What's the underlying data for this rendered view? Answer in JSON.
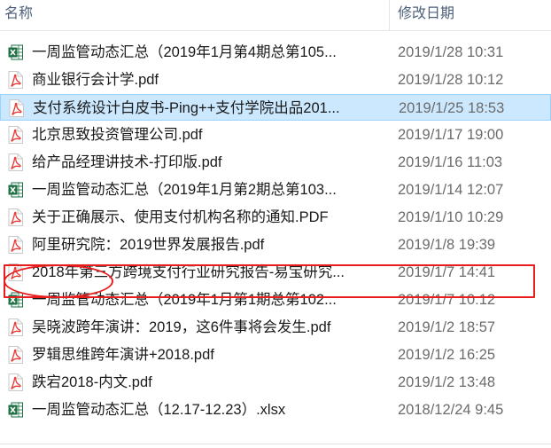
{
  "header": {
    "name_label": "名称",
    "date_label": "修改日期"
  },
  "colors": {
    "selection": "#cce8ff",
    "highlight": "#e81d1d",
    "pdf": "#e53935",
    "excel": "#1e7145"
  },
  "files": [
    {
      "name": "一周监管动态汇总（2019年1月第4期总第105...",
      "date": "2019/1/28 10:31",
      "icon": "excel-icon"
    },
    {
      "name": "商业银行会计学.pdf",
      "date": "2019/1/28 10:12",
      "icon": "pdf-icon"
    },
    {
      "name": "支付系统设计白皮书-Ping++支付学院出品201...",
      "date": "2019/1/25 18:53",
      "icon": "pdf-icon",
      "selected": true
    },
    {
      "name": "北京思致投资管理公司.pdf",
      "date": "2019/1/17 19:00",
      "icon": "pdf-icon"
    },
    {
      "name": "给产品经理讲技术-打印版.pdf",
      "date": "2019/1/16 11:03",
      "icon": "pdf-icon"
    },
    {
      "name": "一周监管动态汇总（2019年1月第2期总第103...",
      "date": "2019/1/14 12:07",
      "icon": "excel-icon"
    },
    {
      "name": "关于正确展示、使用支付机构名称的通知.PDF",
      "date": "2019/1/10 10:29",
      "icon": "pdf-icon"
    },
    {
      "name": "阿里研究院：2019世界发展报告.pdf",
      "date": "2019/1/8 19:39",
      "icon": "pdf-icon"
    },
    {
      "name": "2018年第三方跨境支付行业研究报告-易宝研究...",
      "date": "2019/1/7 14:41",
      "icon": "pdf-icon",
      "highlighted": true
    },
    {
      "name": "一周监管动态汇总（2019年1月第1期总第102...",
      "date": "2019/1/7 10:12",
      "icon": "excel-icon"
    },
    {
      "name": "吴晓波跨年演讲：2019，这6件事将会发生.pdf",
      "date": "2019/1/2 18:57",
      "icon": "pdf-icon"
    },
    {
      "name": "罗辑思维跨年演讲+2018.pdf",
      "date": "2019/1/2 16:25",
      "icon": "pdf-icon"
    },
    {
      "name": "跌宕2018-内文.pdf",
      "date": "2019/1/2 13:48",
      "icon": "pdf-icon"
    },
    {
      "name": "一周监管动态汇总（12.17-12.23）.xlsx",
      "date": "2018/12/24 9:45",
      "icon": "excel-icon"
    }
  ]
}
